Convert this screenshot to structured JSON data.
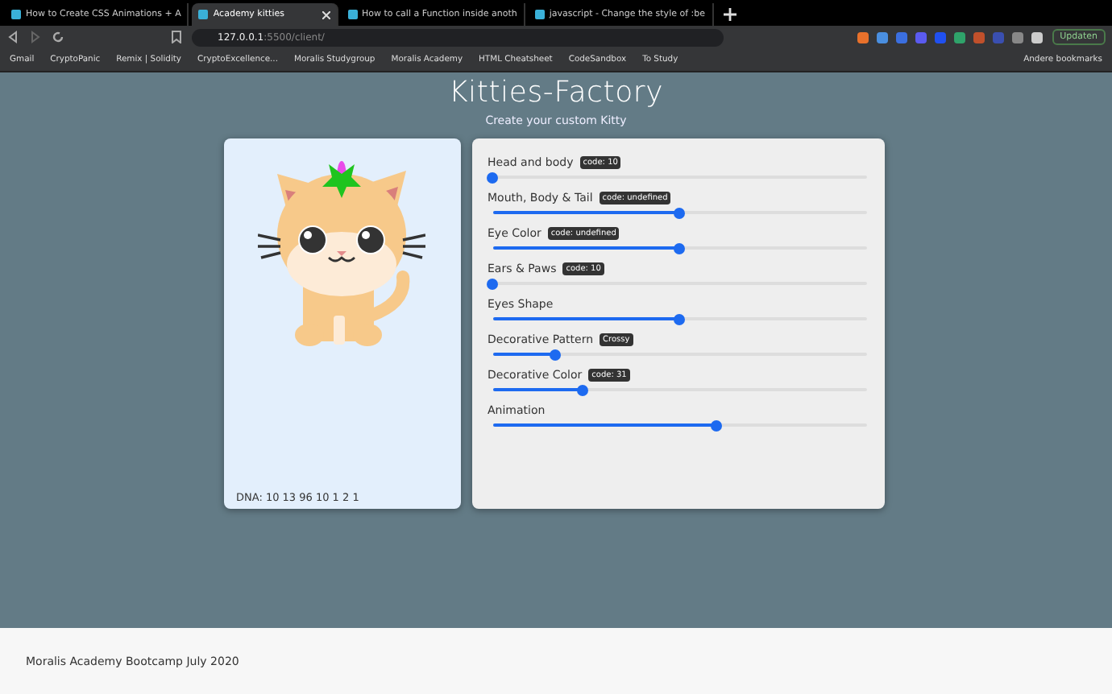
{
  "browser": {
    "tabs": [
      {
        "title": "How to Create CSS Animations + A",
        "selected": false
      },
      {
        "title": "Academy kitties",
        "selected": true
      },
      {
        "title": "How to call a Function inside anoth",
        "selected": false
      },
      {
        "title": "javascript - Change the style of :be",
        "selected": false
      }
    ],
    "address": {
      "host": "127.0.0.1",
      "path": ":5500/client/"
    },
    "update_button": "Updaten",
    "bookmarks": [
      "Gmail",
      "CryptoPanic",
      "Remix | Solidity",
      "CryptoExcellence...",
      "Moralis Studygroup",
      "Moralis Academy",
      "HTML Cheatsheet",
      "CodeSandbox",
      "To Study"
    ],
    "other_bookmarks": "Andere bookmarks"
  },
  "header": {
    "title": "Kitties-Factory",
    "subtitle": "Create your custom Kitty"
  },
  "cat_card": {
    "dna": "DNA: 10 13 96 10 1 2 1"
  },
  "attributes": [
    {
      "label": "Head and body",
      "badge": "code: 10",
      "level": 0
    },
    {
      "label": "Mouth, Body & Tail",
      "badge": "code: undefined",
      "level": 0.5
    },
    {
      "label": "Eye Color",
      "badge": "code: undefined",
      "level": 0.5
    },
    {
      "label": "Ears & Paws",
      "badge": "code: 10",
      "level": 0
    },
    {
      "label": "Eyes Shape",
      "level": 0.5
    },
    {
      "label": "Decorative Pattern",
      "badge": "Crossy",
      "level": 0.17
    },
    {
      "label": "Decorative Color",
      "badge": "code: 31",
      "level": 0.24
    },
    {
      "label": "Animation",
      "level": 0.6
    }
  ],
  "footer": {
    "text": "Moralis Academy Bootcamp July 2020"
  }
}
